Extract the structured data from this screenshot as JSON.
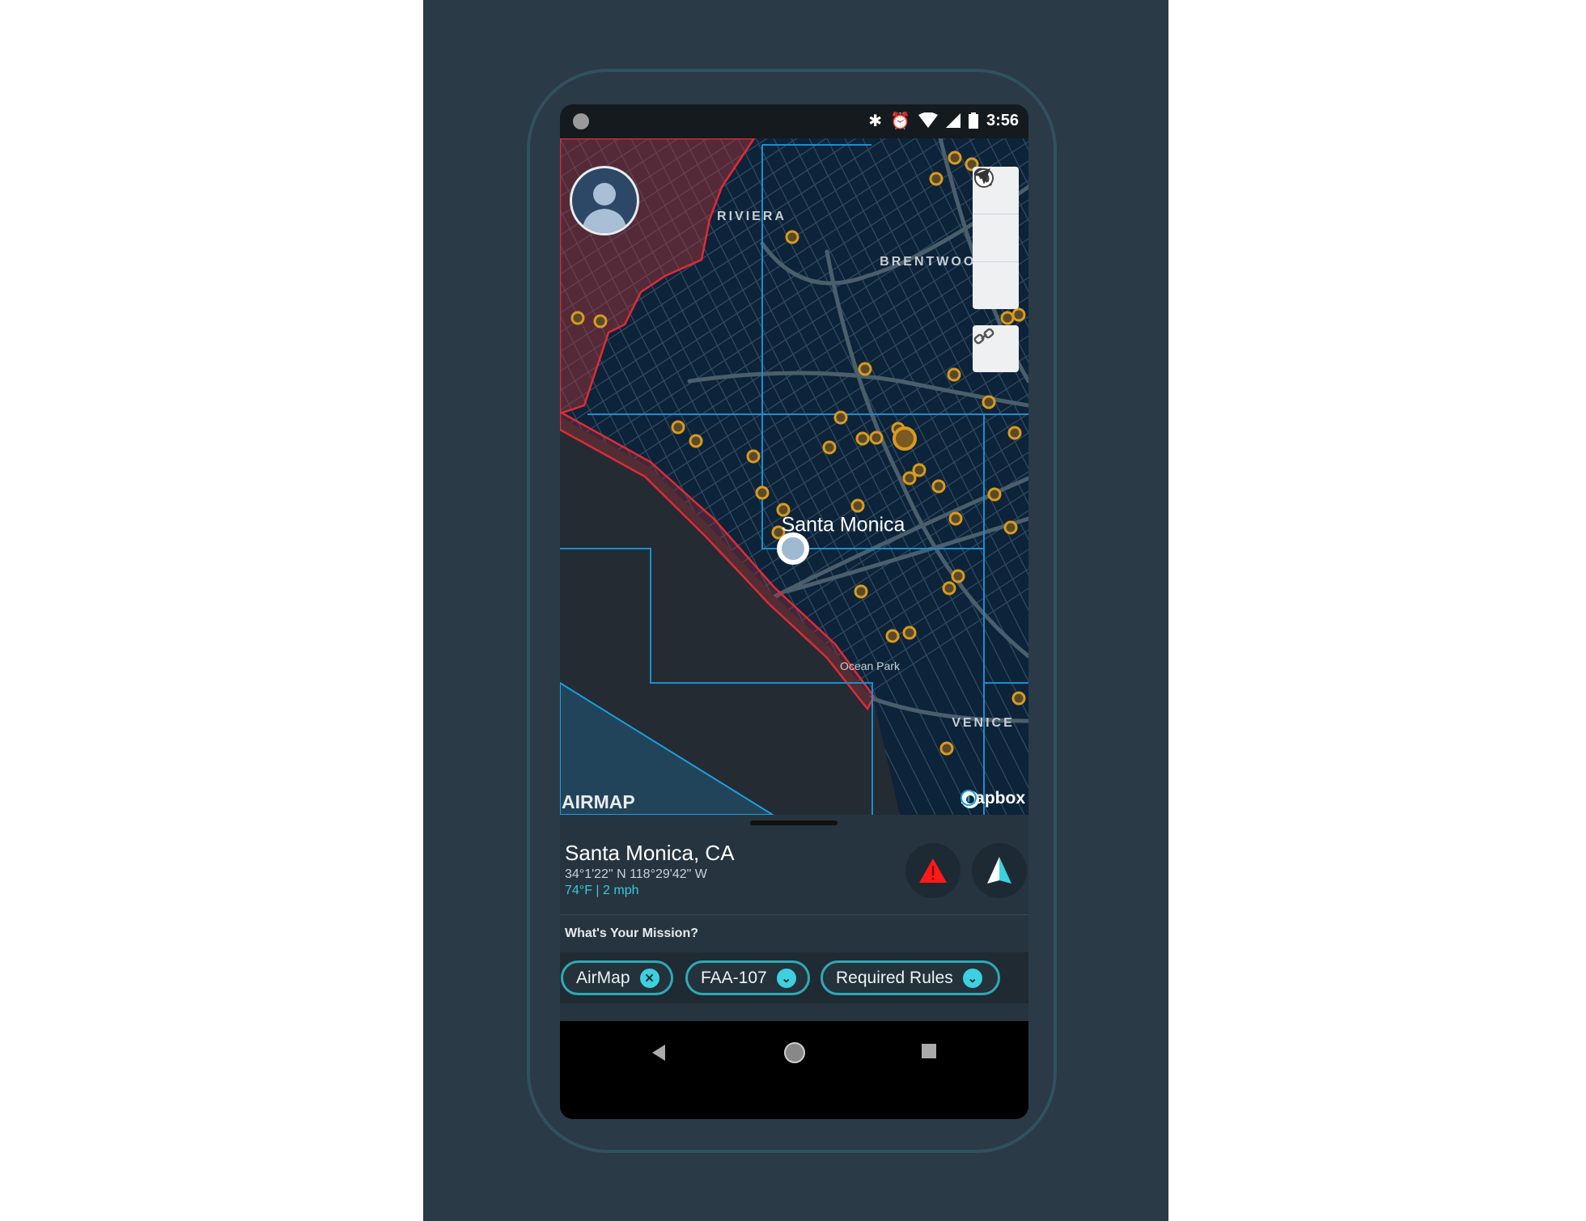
{
  "status_bar": {
    "time": "3:56",
    "icons": [
      "bluetooth-icon",
      "alarm-icon",
      "wifi-icon",
      "signal-icon",
      "battery-icon"
    ]
  },
  "map": {
    "labels": {
      "riviera": "RIVIERA",
      "brentwood": "BRENTWOOD",
      "santa_monica": "Santa Monica",
      "ocean_park": "Ocean Park",
      "venice": "VENICE"
    },
    "controls": [
      "search-icon",
      "globe-icon",
      "location-arrow-icon",
      "link-icon"
    ],
    "logo": "AIRMAP",
    "attribution": "mapbox",
    "colors": {
      "land": "#0d2339",
      "water": "#242b33",
      "restricted": "#e02a36",
      "boundary": "#1a8fd0",
      "marker": "#d99a1e"
    }
  },
  "location": {
    "title": "Santa Monica, CA",
    "coords": "34°1'22\" N  118°29'42\" W",
    "weather": "74°F | 2 mph"
  },
  "mission": {
    "label": "What's Your Mission?",
    "chips": [
      {
        "label": "AirMap",
        "icon": "close-icon"
      },
      {
        "label": "FAA-107",
        "icon": "chevron-down-icon"
      },
      {
        "label": "Required Rules",
        "icon": "chevron-down-icon"
      }
    ]
  },
  "accent": "#3cc8d8"
}
